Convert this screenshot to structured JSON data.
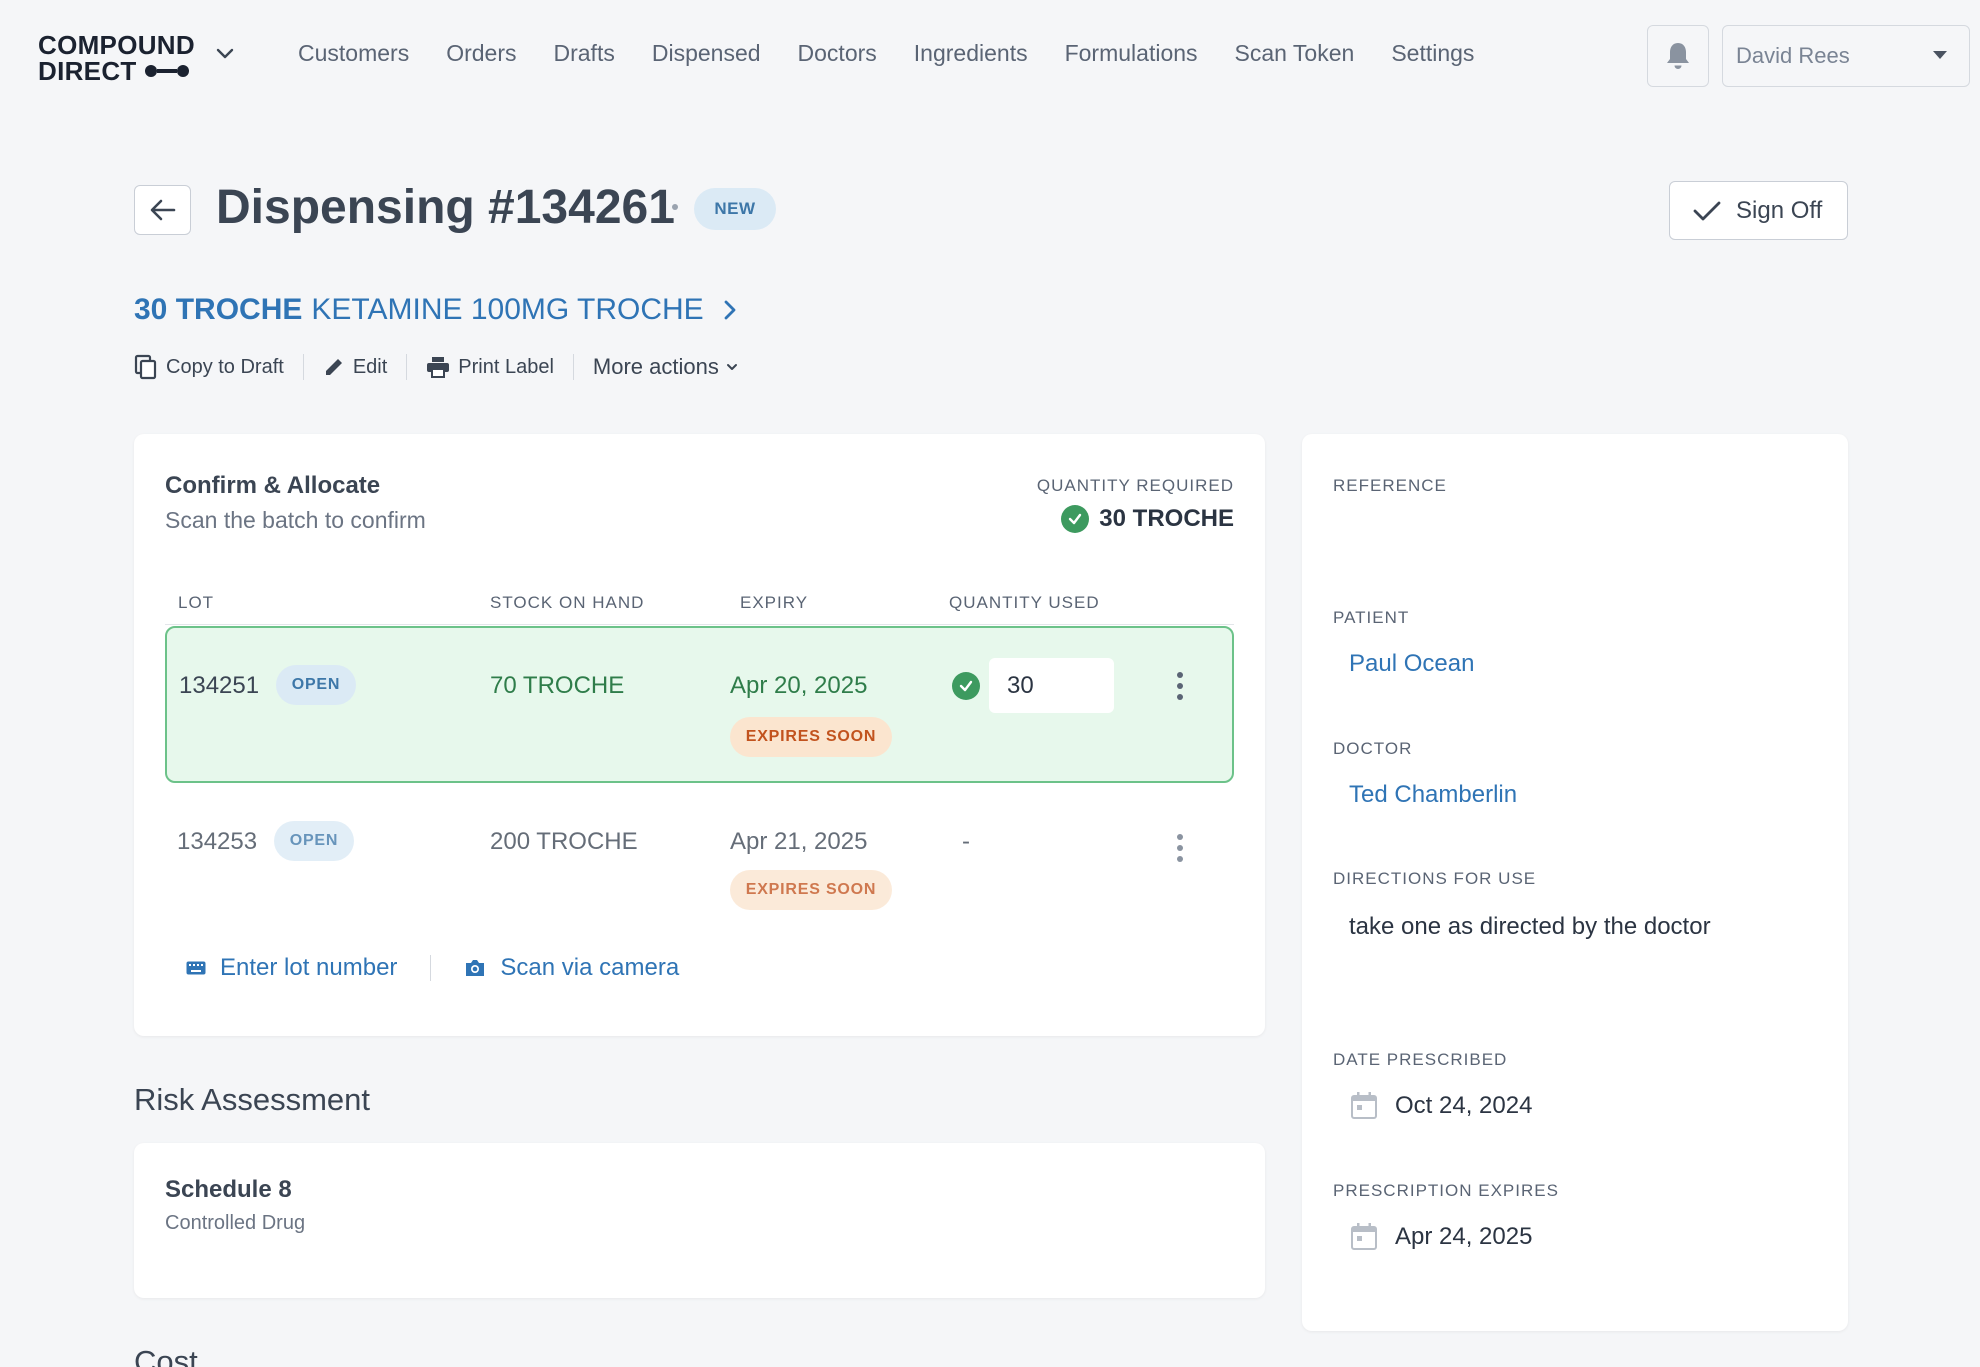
{
  "app": {
    "logo_line1": "COMPOUND",
    "logo_line2": "DIRECT"
  },
  "nav": {
    "items": [
      "Customers",
      "Orders",
      "Drafts",
      "Dispensed",
      "Doctors",
      "Ingredients",
      "Formulations",
      "Scan Token",
      "Settings"
    ],
    "user": "David Rees"
  },
  "header": {
    "title": "Dispensing #134261",
    "status": "NEW",
    "signoff_label": "Sign Off"
  },
  "product": {
    "quantity": "30 TROCHE",
    "name": "KETAMINE 100MG TROCHE"
  },
  "actions": {
    "copy_to_draft": "Copy to Draft",
    "edit": "Edit",
    "print_label": "Print Label",
    "more_actions": "More actions"
  },
  "allocate": {
    "title": "Confirm & Allocate",
    "subtitle": "Scan the batch to confirm",
    "quantity_required_label": "QUANTITY REQUIRED",
    "quantity_required_value": "30 TROCHE",
    "columns": {
      "lot": "LOT",
      "stock_on_hand": "STOCK ON HAND",
      "expiry": "EXPIRY",
      "quantity_used": "QUANTITY USED"
    },
    "rows": [
      {
        "lot": "134251",
        "status": "OPEN",
        "stock": "70 TROCHE",
        "expiry": "Apr 20, 2025",
        "expiry_badge": "EXPIRES SOON",
        "quantity_used": "30"
      },
      {
        "lot": "134253",
        "status": "OPEN",
        "stock": "200 TROCHE",
        "expiry": "Apr 21, 2025",
        "expiry_badge": "EXPIRES SOON",
        "quantity_used": "-"
      }
    ],
    "enter_lot_label": "Enter lot number",
    "scan_camera_label": "Scan via camera"
  },
  "risk": {
    "heading": "Risk Assessment",
    "title": "Schedule 8",
    "subtitle": "Controlled Drug"
  },
  "cost": {
    "heading": "Cost"
  },
  "details": {
    "reference_label": "REFERENCE",
    "patient_label": "PATIENT",
    "patient": "Paul Ocean",
    "doctor_label": "DOCTOR",
    "doctor": "Ted Chamberlin",
    "directions_label": "DIRECTIONS FOR USE",
    "directions": "take one as directed by the doctor",
    "date_prescribed_label": "DATE PRESCRIBED",
    "date_prescribed": "Oct 24, 2024",
    "prescription_expires_label": "PRESCRIPTION EXPIRES",
    "prescription_expires": "Apr 24, 2025"
  }
}
